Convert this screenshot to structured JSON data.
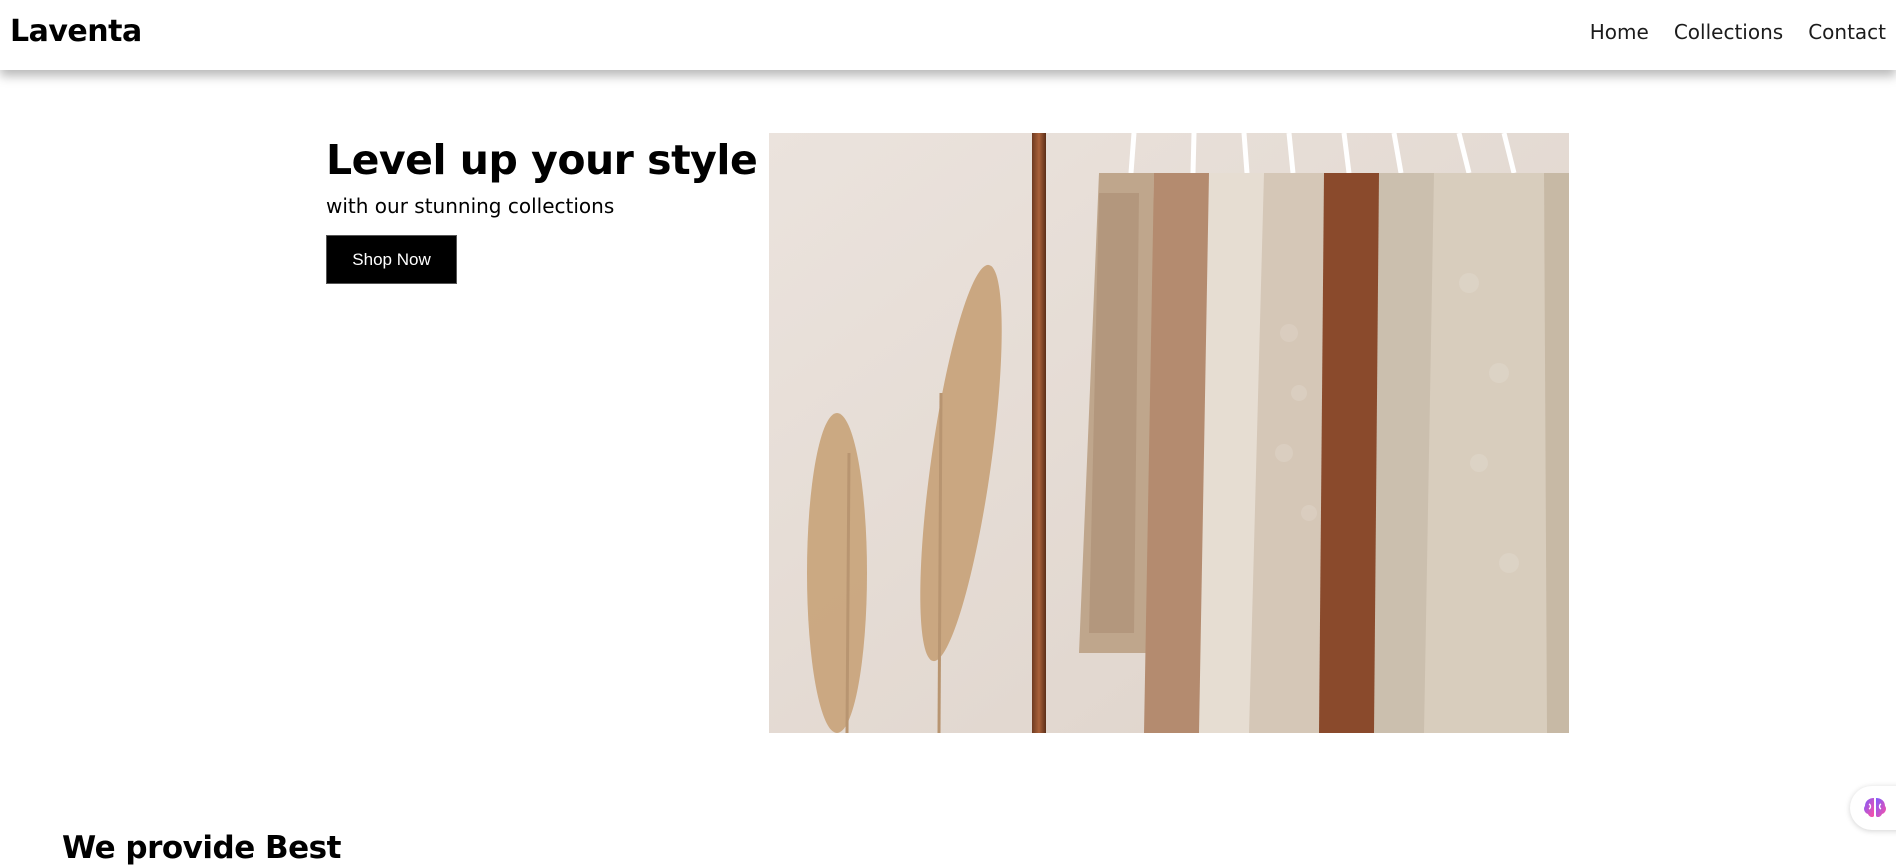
{
  "navbar": {
    "brand": "Laventa",
    "links": [
      "Home",
      "Collections",
      "Contact"
    ]
  },
  "hero": {
    "title": "Level up your style",
    "subtitle": "with our stunning collections",
    "cta_label": "Shop Now",
    "image_icon": "clothing-rack-photo"
  },
  "section": {
    "title": "We provide Best"
  },
  "floating_widget": {
    "icon": "brain-icon"
  },
  "colors": {
    "button_bg": "#000000",
    "button_text": "#ffffff",
    "background": "#ffffff",
    "nav_text": "#1c1c1c"
  }
}
